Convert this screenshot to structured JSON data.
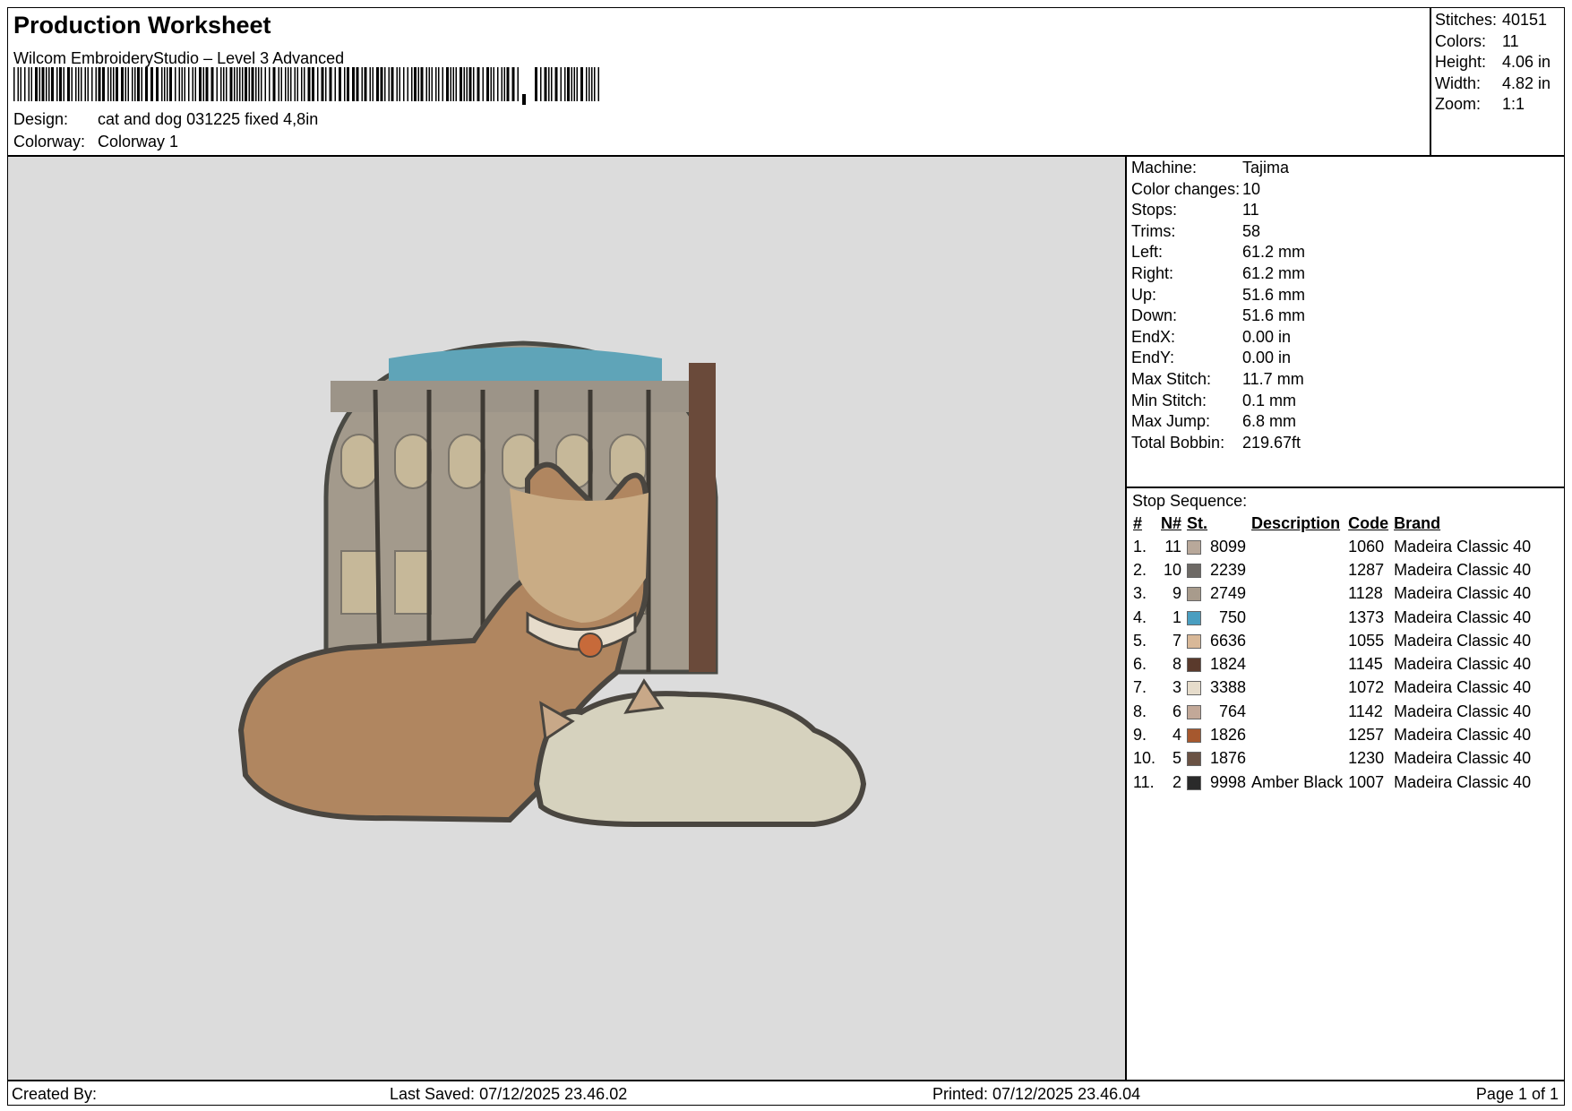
{
  "header": {
    "title": "Production Worksheet",
    "software": "Wilcom EmbroideryStudio – Level 3 Advanced",
    "design_label": "Design:",
    "design_value": "cat and dog 031225 fixed 4,8in",
    "colorway_label": "Colorway:",
    "colorway_value": "Colorway 1"
  },
  "summary": [
    {
      "label": "Stitches:",
      "value": "40151"
    },
    {
      "label": "Colors:",
      "value": "11"
    },
    {
      "label": "Height:",
      "value": "4.06 in"
    },
    {
      "label": "Width:",
      "value": "4.82 in"
    },
    {
      "label": "Zoom:",
      "value": "1:1"
    }
  ],
  "machine_info": [
    {
      "label": "Machine:",
      "value": "Tajima"
    },
    {
      "label": "Color changes:",
      "value": "10"
    },
    {
      "label": "Stops:",
      "value": "11"
    },
    {
      "label": "Trims:",
      "value": "58"
    },
    {
      "label": "Left:",
      "value": "61.2 mm"
    },
    {
      "label": "Right:",
      "value": "61.2 mm"
    },
    {
      "label": "Up:",
      "value": "51.6 mm"
    },
    {
      "label": "Down:",
      "value": "51.6 mm"
    },
    {
      "label": "EndX:",
      "value": "0.00 in"
    },
    {
      "label": "EndY:",
      "value": "0.00 in"
    },
    {
      "label": "Max Stitch:",
      "value": "11.7 mm"
    },
    {
      "label": "Min Stitch:",
      "value": "0.1 mm"
    },
    {
      "label": "Max Jump:",
      "value": "6.8 mm"
    },
    {
      "label": "Total Bobbin:",
      "value": "219.67ft"
    }
  ],
  "stop_sequence": {
    "title": "Stop Sequence:",
    "columns": [
      "#",
      "N#",
      "St.",
      "Description",
      "Code",
      "Brand"
    ],
    "rows": [
      {
        "idx": "1.",
        "n": "11",
        "color": "#b8a89a",
        "st": "8099",
        "desc": "",
        "code": "1060",
        "brand": "Madeira Classic 40"
      },
      {
        "idx": "2.",
        "n": "10",
        "color": "#6e6a66",
        "st": "2239",
        "desc": "",
        "code": "1287",
        "brand": "Madeira Classic 40"
      },
      {
        "idx": "3.",
        "n": "9",
        "color": "#a89b8c",
        "st": "2749",
        "desc": "",
        "code": "1128",
        "brand": "Madeira Classic 40"
      },
      {
        "idx": "4.",
        "n": "1",
        "color": "#4a9ec0",
        "st": "750",
        "desc": "",
        "code": "1373",
        "brand": "Madeira Classic 40"
      },
      {
        "idx": "5.",
        "n": "7",
        "color": "#d8b898",
        "st": "6636",
        "desc": "",
        "code": "1055",
        "brand": "Madeira Classic 40"
      },
      {
        "idx": "6.",
        "n": "8",
        "color": "#5a3a2c",
        "st": "1824",
        "desc": "",
        "code": "1145",
        "brand": "Madeira Classic 40"
      },
      {
        "idx": "7.",
        "n": "3",
        "color": "#e6dccb",
        "st": "3388",
        "desc": "",
        "code": "1072",
        "brand": "Madeira Classic 40"
      },
      {
        "idx": "8.",
        "n": "6",
        "color": "#c2a898",
        "st": "764",
        "desc": "",
        "code": "1142",
        "brand": "Madeira Classic 40"
      },
      {
        "idx": "9.",
        "n": "4",
        "color": "#a6582e",
        "st": "1826",
        "desc": "",
        "code": "1257",
        "brand": "Madeira Classic 40"
      },
      {
        "idx": "10.",
        "n": "5",
        "color": "#6a5244",
        "st": "1876",
        "desc": "",
        "code": "1230",
        "brand": "Madeira Classic 40"
      },
      {
        "idx": "11.",
        "n": "2",
        "color": "#2a2a2a",
        "st": "9998",
        "desc": "Amber Black",
        "code": "1007",
        "brand": "Madeira Classic 40"
      }
    ]
  },
  "footer": {
    "created_by": "Created By:",
    "last_saved": "Last Saved: 07/12/2025 23.46.02",
    "printed": "Printed: 07/12/2025 23.46.04",
    "page": "Page 1 of 1"
  }
}
